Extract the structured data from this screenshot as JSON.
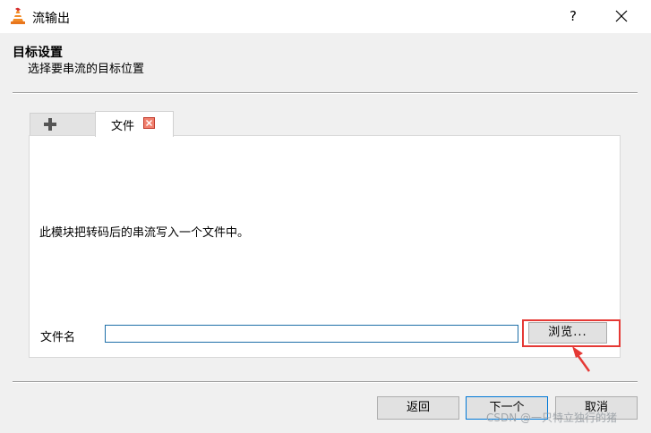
{
  "window": {
    "title": "流输出",
    "help_label": "?",
    "app_icon": "vlc-cone-icon",
    "close_icon": "close-icon"
  },
  "header": {
    "title": "目标设置",
    "subtitle": "选择要串流的目标位置"
  },
  "tabs": [
    {
      "icon": "plus-icon",
      "selected": false
    },
    {
      "label": "文件",
      "close_icon": "tab-close-icon",
      "selected": true
    }
  ],
  "panel": {
    "description": "此模块把转码后的串流写入一个文件中。",
    "filename_label": "文件名",
    "filename_value": "",
    "browse_label": "浏览..."
  },
  "buttons": {
    "back": "返回",
    "next": "下一个",
    "cancel": "取消"
  },
  "watermark": "CSDN @一只特立独行的猪",
  "colors": {
    "highlight": "#e53935",
    "input_border": "#1e6fa8",
    "tab_close": "#f1806e"
  }
}
